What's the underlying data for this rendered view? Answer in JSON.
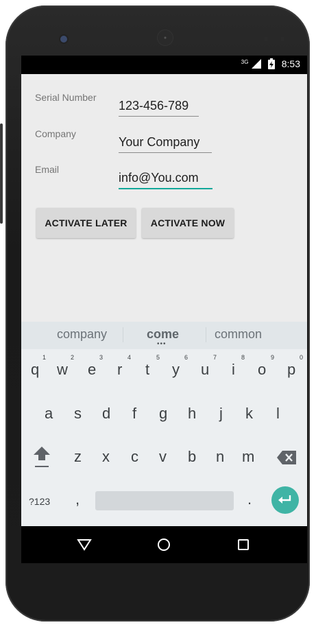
{
  "status_bar": {
    "network": "3G",
    "time": "8:53"
  },
  "form": {
    "serial_label": "Serial Number",
    "serial_value": "123-456-789",
    "company_label": "Company",
    "company_value": "Your Company",
    "email_label": "Email",
    "email_value": "info@You.com"
  },
  "buttons": {
    "later": "ACTIVATE LATER",
    "now": "ACTIVATE NOW"
  },
  "suggestions": [
    "company",
    "come",
    "common"
  ],
  "keyboard": {
    "row1": [
      "q",
      "w",
      "e",
      "r",
      "t",
      "y",
      "u",
      "i",
      "o",
      "p"
    ],
    "row1_numbers": [
      "1",
      "2",
      "3",
      "4",
      "5",
      "6",
      "7",
      "8",
      "9",
      "0"
    ],
    "row2": [
      "a",
      "s",
      "d",
      "f",
      "g",
      "h",
      "j",
      "k",
      "l"
    ],
    "row3": [
      "z",
      "x",
      "c",
      "v",
      "b",
      "n",
      "m"
    ],
    "symbols_label": "?123",
    "comma": ",",
    "period": "."
  },
  "colors": {
    "accent": "#12a89a",
    "enter_key": "#3fb4a5"
  },
  "icons": [
    "signal-icon",
    "battery-icon",
    "shift-icon",
    "backspace-icon",
    "enter-icon",
    "back-icon",
    "home-icon",
    "recents-icon"
  ]
}
